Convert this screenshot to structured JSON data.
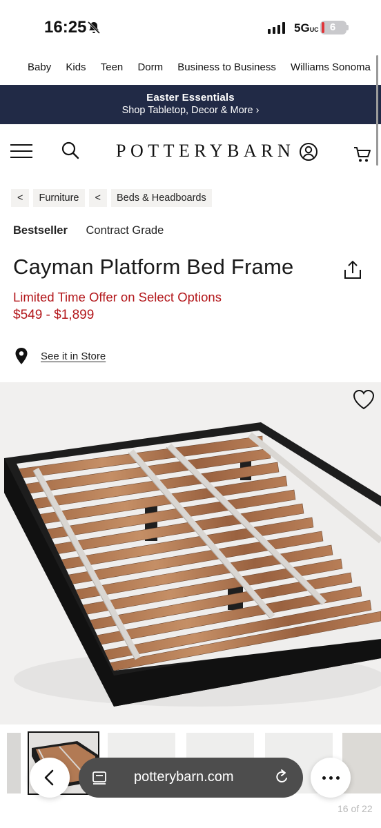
{
  "status_bar": {
    "time": "16:25",
    "network": "5G",
    "network_suffix": "UC",
    "battery": "6",
    "icons": [
      "bell-slash-icon",
      "signal-icon",
      "battery-icon"
    ]
  },
  "top_nav": [
    "Baby",
    "Kids",
    "Teen",
    "Dorm",
    "Business to Business",
    "Williams Sonoma"
  ],
  "promo": {
    "title": "Easter Essentials",
    "subtitle": "Shop Tabletop, Decor & More ›"
  },
  "header": {
    "logo": "POTTERYBARN",
    "icons": [
      "menu-icon",
      "search-icon",
      "account-icon",
      "cart-icon"
    ]
  },
  "breadcrumb": [
    {
      "arrow": "<",
      "label": "Furniture"
    },
    {
      "arrow": "<",
      "label": "Beds & Headboards"
    }
  ],
  "badges": {
    "bestseller": "Bestseller",
    "contract": "Contract Grade"
  },
  "product": {
    "title": "Cayman Platform Bed Frame",
    "offer": "Limited Time Offer on Select Options",
    "price": "$549 - $1,899"
  },
  "store": {
    "label": "See it in Store"
  },
  "gallery": {
    "counter": "16 of 22"
  },
  "browser": {
    "url": "potterybarn.com"
  },
  "colors": {
    "brand_navy": "#212a46",
    "price_red": "#b3171b"
  }
}
